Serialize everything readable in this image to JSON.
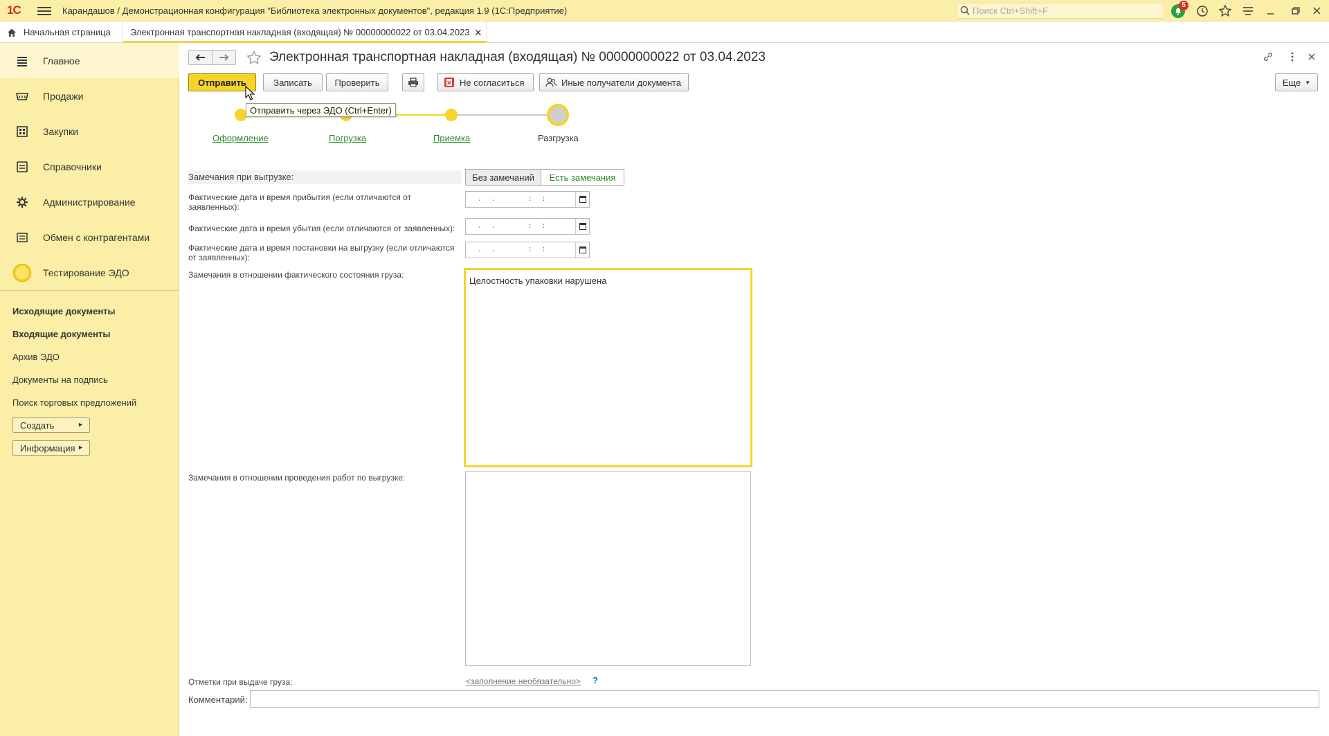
{
  "app": {
    "logo_text": "1С",
    "title": "Карандашов / Демонстрационная конфигурация \"Библиотека электронных документов\", редакция 1.9  (1С:Предприятие)",
    "search_placeholder": "Поиск Ctrl+Shift+F",
    "notifications_count": "5"
  },
  "tabs": {
    "home_label": "Начальная страница",
    "doc_label": "Электронная транспортная накладная (входящая) № 00000000022 от 03.04.2023"
  },
  "sidebar": {
    "sections": [
      {
        "label": "Главное",
        "icon": "menu-icon"
      },
      {
        "label": "Продажи",
        "icon": "cart-icon"
      },
      {
        "label": "Закупки",
        "icon": "warehouse-icon"
      },
      {
        "label": "Справочники",
        "icon": "book-icon"
      },
      {
        "label": "Администрирование",
        "icon": "gear-icon"
      },
      {
        "label": "Обмен с контрагентами",
        "icon": "exchange-icon"
      },
      {
        "label": "Тестирование ЭДО",
        "icon": "circle-icon"
      }
    ],
    "links": [
      {
        "label": "Исходящие документы",
        "bold": true
      },
      {
        "label": "Входящие документы",
        "bold": true
      },
      {
        "label": "Архив ЭДО",
        "bold": false
      },
      {
        "label": "Документы на подпись",
        "bold": false
      },
      {
        "label": "Поиск торговых предложений",
        "bold": false
      }
    ],
    "buttons": {
      "create": "Создать",
      "info": "Информация"
    }
  },
  "document": {
    "title": "Электронная транспортная накладная (входящая) № 00000000022 от 03.04.2023",
    "toolbar": {
      "send": "Отправить",
      "save": "Записать",
      "check": "Проверить",
      "disagree": "Не согласиться",
      "other_recipients": "Иные получатели документа",
      "more": "Еще"
    },
    "tooltip": "Отправить через ЭДО (Ctrl+Enter)",
    "steps": [
      {
        "label": "Оформление",
        "state": "done"
      },
      {
        "label": "Погрузка",
        "state": "done"
      },
      {
        "label": "Приемка",
        "state": "done"
      },
      {
        "label": "Разгрузка",
        "state": "current"
      }
    ],
    "form": {
      "remarks_label": "Замечания при выгрузке:",
      "remarks_options": [
        "Без замечаний",
        "Есть замечания"
      ],
      "remarks_selected": "Есть замечания",
      "arrival_label": "Фактические дата и время прибытия (если отличаются от заявленных):",
      "departure_label": "Фактические дата и время убытия (если отличаются от заявленных):",
      "unloading_label": "Фактические дата и время постановки на выгрузку (если отличаются от заявленных):",
      "date_placeholder": " .  .       :  :",
      "cargo_state_label": "Замечания в отношении фактического состояния груза:",
      "cargo_state_value": "Целостность упаковки нарушена",
      "works_label": "Замечания в отношении проведения работ по выгрузке:",
      "works_value": "",
      "marks_label": "Отметки при выдаче груза:",
      "marks_link": "<заполнение необязательно>",
      "help": "?",
      "comment_label": "Комментарий:",
      "comment_value": ""
    }
  },
  "colors": {
    "accent_yellow": "#f6d42a",
    "sidebar_bg": "#fbeea6",
    "link_green": "#2a8a2a",
    "notification_red": "#e52b1b"
  }
}
